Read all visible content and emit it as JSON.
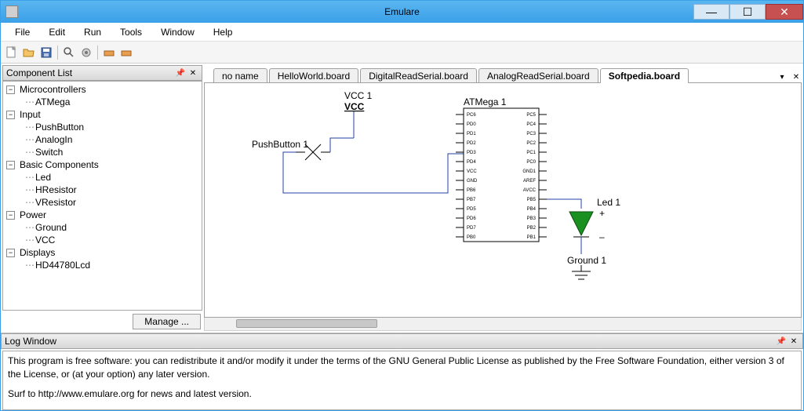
{
  "window": {
    "title": "Emulare"
  },
  "menubar": [
    "File",
    "Edit",
    "Run",
    "Tools",
    "Window",
    "Help"
  ],
  "sidebar": {
    "title": "Component List",
    "manage": "Manage ...",
    "groups": [
      {
        "label": "Microcontrollers",
        "items": [
          "ATMega"
        ]
      },
      {
        "label": "Input",
        "items": [
          "PushButton",
          "AnalogIn",
          "Switch"
        ]
      },
      {
        "label": "Basic Components",
        "items": [
          "Led",
          "HResistor",
          "VResistor"
        ]
      },
      {
        "label": "Power",
        "items": [
          "Ground",
          "VCC"
        ]
      },
      {
        "label": "Displays",
        "items": [
          "HD44780Lcd"
        ]
      }
    ]
  },
  "tabs": {
    "items": [
      "no name",
      "HelloWorld.board",
      "DigitalReadSerial.board",
      "AnalogReadSerial.board",
      "Softpedia.board"
    ],
    "active": 4
  },
  "canvas": {
    "vcc_label": "VCC 1",
    "vcc_text": "VCC",
    "pushbutton_label": "PushButton 1",
    "atmega_label": "ATMega 1",
    "led_label": "Led 1",
    "ground_label": "Ground 1",
    "pins_left": [
      "PC6",
      "PD0",
      "PD1",
      "PD2",
      "PD3",
      "PD4",
      "VCC",
      "GND",
      "PB6",
      "PB7",
      "PD5",
      "PD6",
      "PD7",
      "PB0"
    ],
    "pins_right": [
      "PC5",
      "PC4",
      "PC3",
      "PC2",
      "PC1",
      "PC0",
      "GND1",
      "AREF",
      "AVCC",
      "PB5",
      "PB4",
      "PB3",
      "PB2",
      "PB1"
    ]
  },
  "log": {
    "title": "Log Window",
    "line1": "This program is free software: you can redistribute it and/or modify it under the terms of the GNU General Public License as published by the Free Software Foundation, either version 3 of the License, or (at your option) any later version.",
    "line2": "Surf to http://www.emulare.org for news and latest version."
  }
}
